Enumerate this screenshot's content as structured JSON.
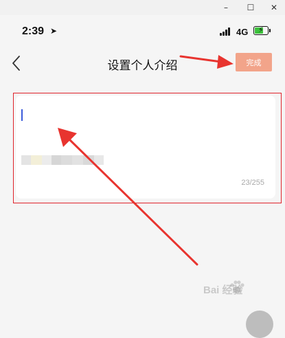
{
  "window_controls": {
    "minimize": "–",
    "maximize": "☐",
    "close": "✕"
  },
  "status_bar": {
    "time": "2:39",
    "network": "4G"
  },
  "nav": {
    "title": "设置个人介绍",
    "done_label": "完成"
  },
  "editor": {
    "counter": "23/255"
  },
  "watermark": {
    "text": "Bai 经验"
  },
  "colors": {
    "accent": "#f2a48a",
    "highlight": "#e0222a",
    "cursor": "#3b5bdb"
  }
}
